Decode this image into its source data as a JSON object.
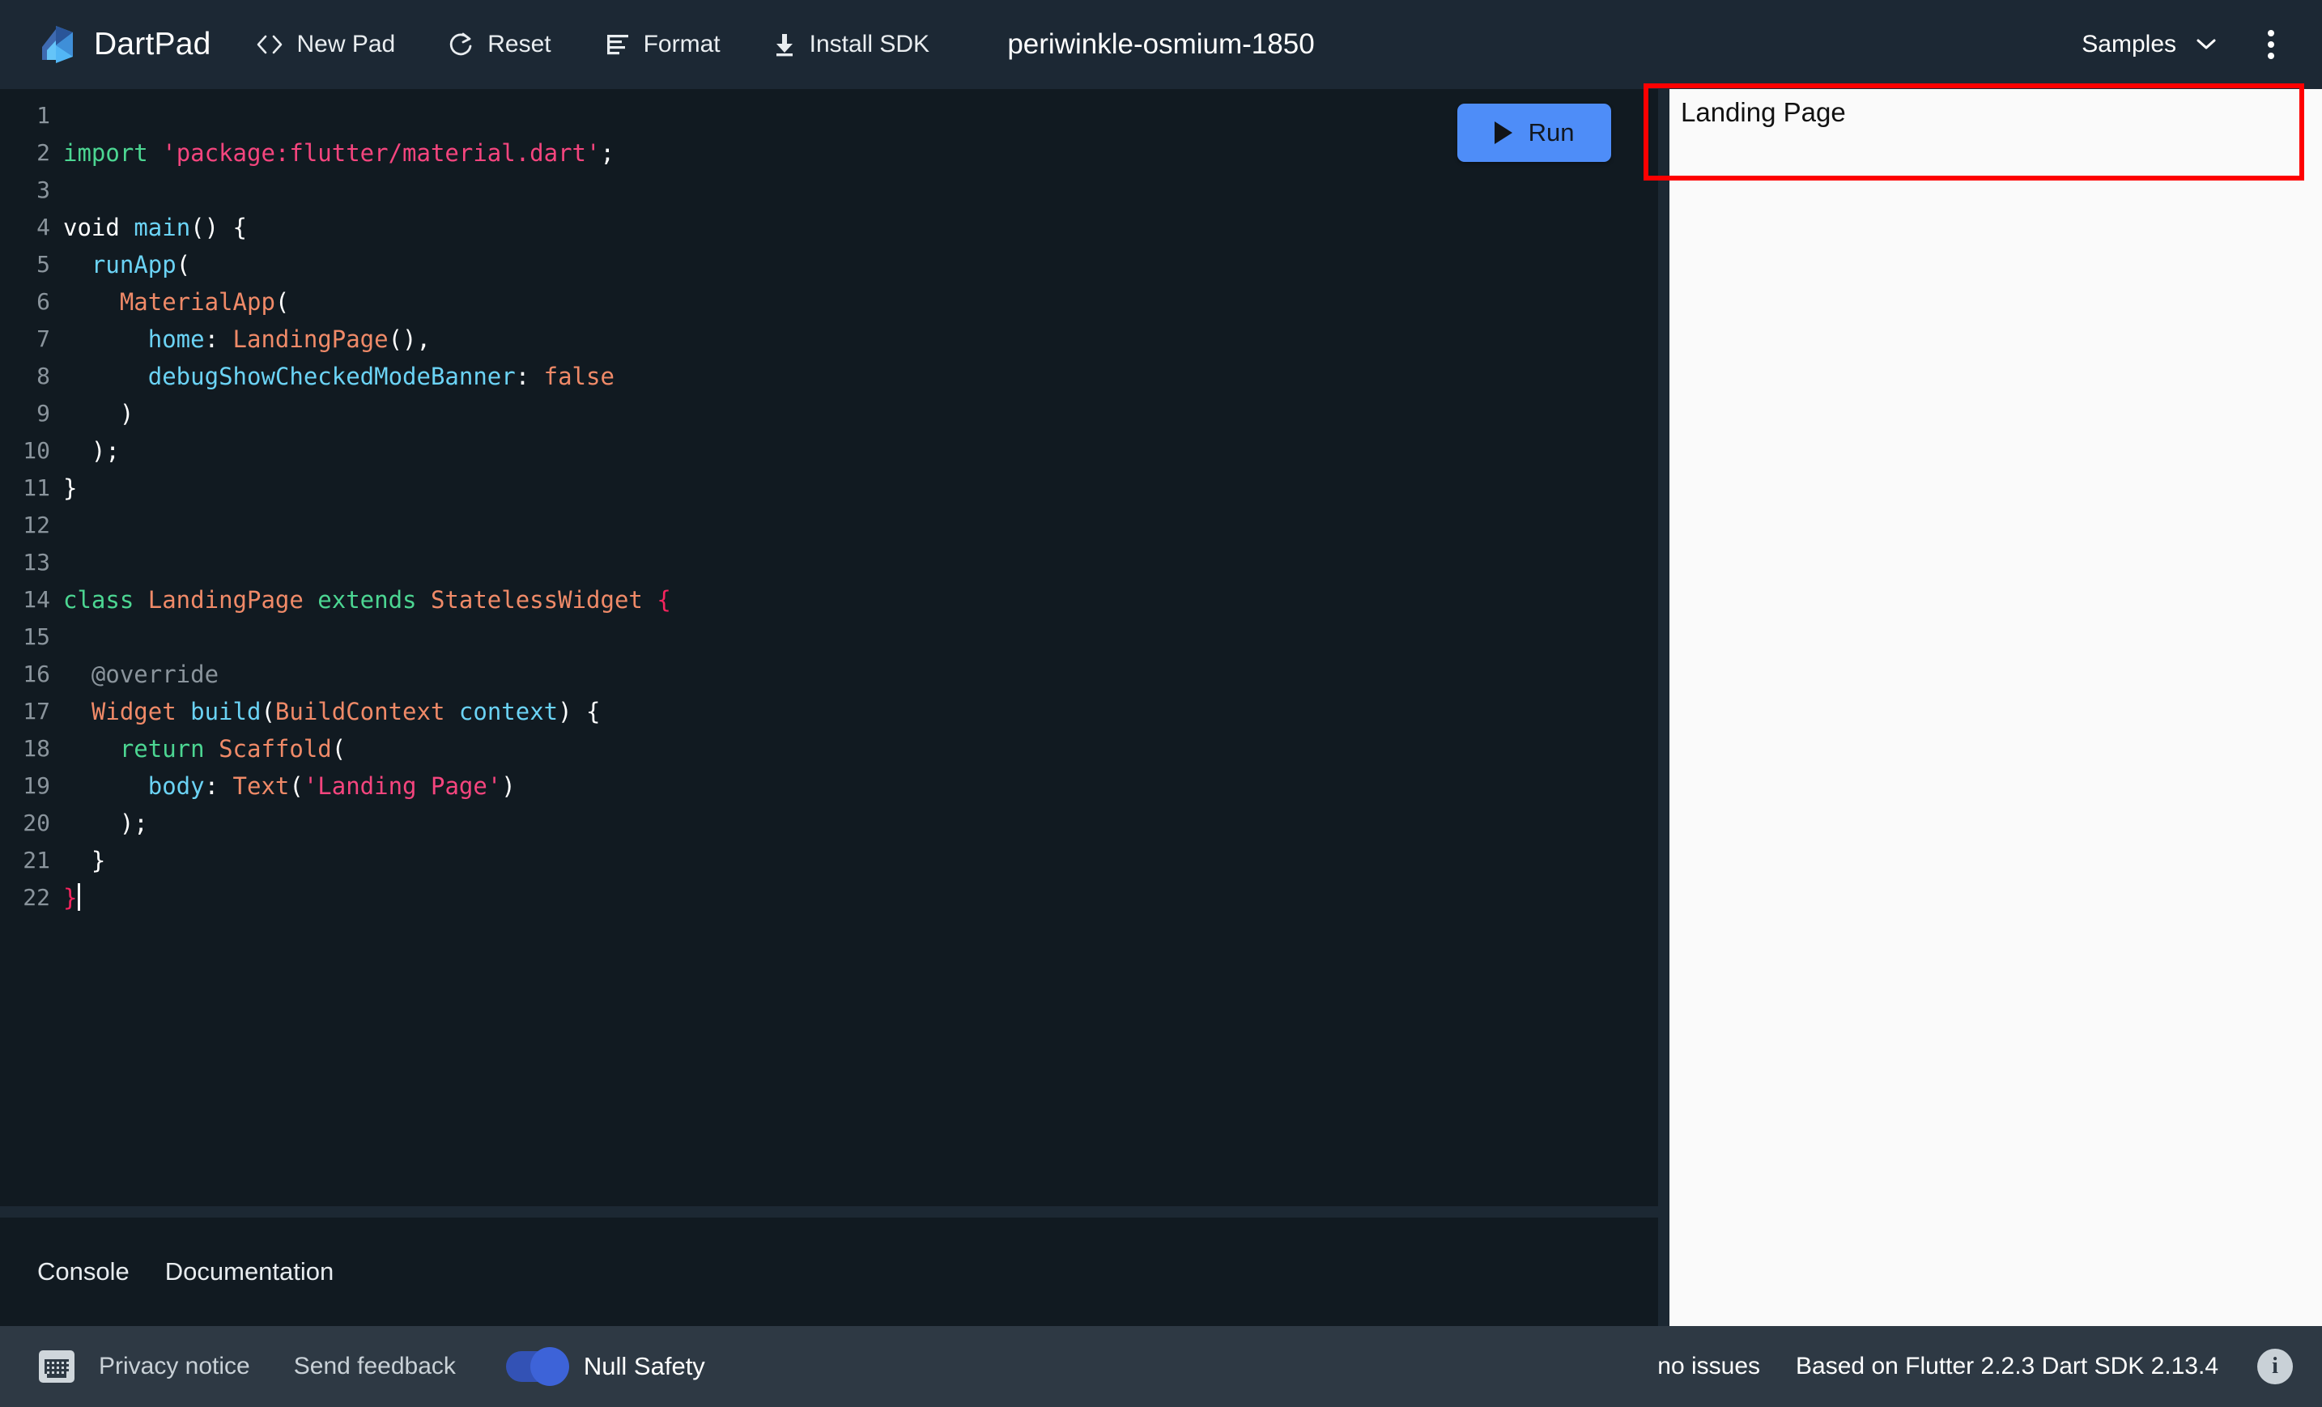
{
  "header": {
    "brand": "DartPad",
    "brand_logo_icon": "dartpad-logo-icon",
    "buttons": [
      {
        "label": "New Pad",
        "icon": "code-brackets-icon"
      },
      {
        "label": "Reset",
        "icon": "refresh-icon"
      },
      {
        "label": "Format",
        "icon": "format-lines-icon"
      },
      {
        "label": "Install SDK",
        "icon": "download-icon"
      }
    ],
    "doc_title": "periwinkle-osmium-1850",
    "samples_label": "Samples",
    "samples_icon": "chevron-down-icon",
    "more_icon": "more-vertical-icon"
  },
  "editor": {
    "run_label": "Run",
    "run_icon": "play-icon",
    "line_numbers": [
      "1",
      "2",
      "3",
      "4",
      "5",
      "6",
      "7",
      "8",
      "9",
      "10",
      "11",
      "12",
      "13",
      "14",
      "15",
      "16",
      "17",
      "18",
      "19",
      "20",
      "21",
      "22"
    ],
    "code_lines": [
      "",
      "import 'package:flutter/material.dart';",
      "",
      "void main() {",
      "  runApp(",
      "    MaterialApp(",
      "      home: LandingPage(),",
      "      debugShowCheckedModeBanner: false",
      "    )",
      "  );",
      "}",
      "",
      "",
      "class LandingPage extends StatelessWidget {",
      "",
      "  @override",
      "  Widget build(BuildContext context) {",
      "    return Scaffold(",
      "      body: Text('Landing Page')",
      "    );",
      "  }",
      "}"
    ],
    "colors": {
      "background": "#111a21",
      "line_number": "#8a949c",
      "keyword": "#4cd692",
      "string": "#f5457e",
      "plain": "#ffffff",
      "named_param": "#6bd3f5",
      "type": "#f08a68",
      "comment_annotation": "#8a949c",
      "matching_bracket": "#f5245e",
      "run_button": "#4e8df8"
    }
  },
  "preview": {
    "text": "Landing Page",
    "annotation_color": "#fe0000"
  },
  "bottom_tabs": {
    "tabs": [
      {
        "label": "Console"
      },
      {
        "label": "Documentation"
      }
    ]
  },
  "statusbar": {
    "keyboard_icon": "keyboard-icon",
    "privacy_notice": "Privacy notice",
    "send_feedback": "Send feedback",
    "null_safety_label": "Null Safety",
    "null_safety_on": true,
    "no_issues": "no issues",
    "sdk_info": "Based on Flutter 2.2.3 Dart SDK 2.13.4",
    "info_icon": "info-icon",
    "info_glyph": "i"
  }
}
